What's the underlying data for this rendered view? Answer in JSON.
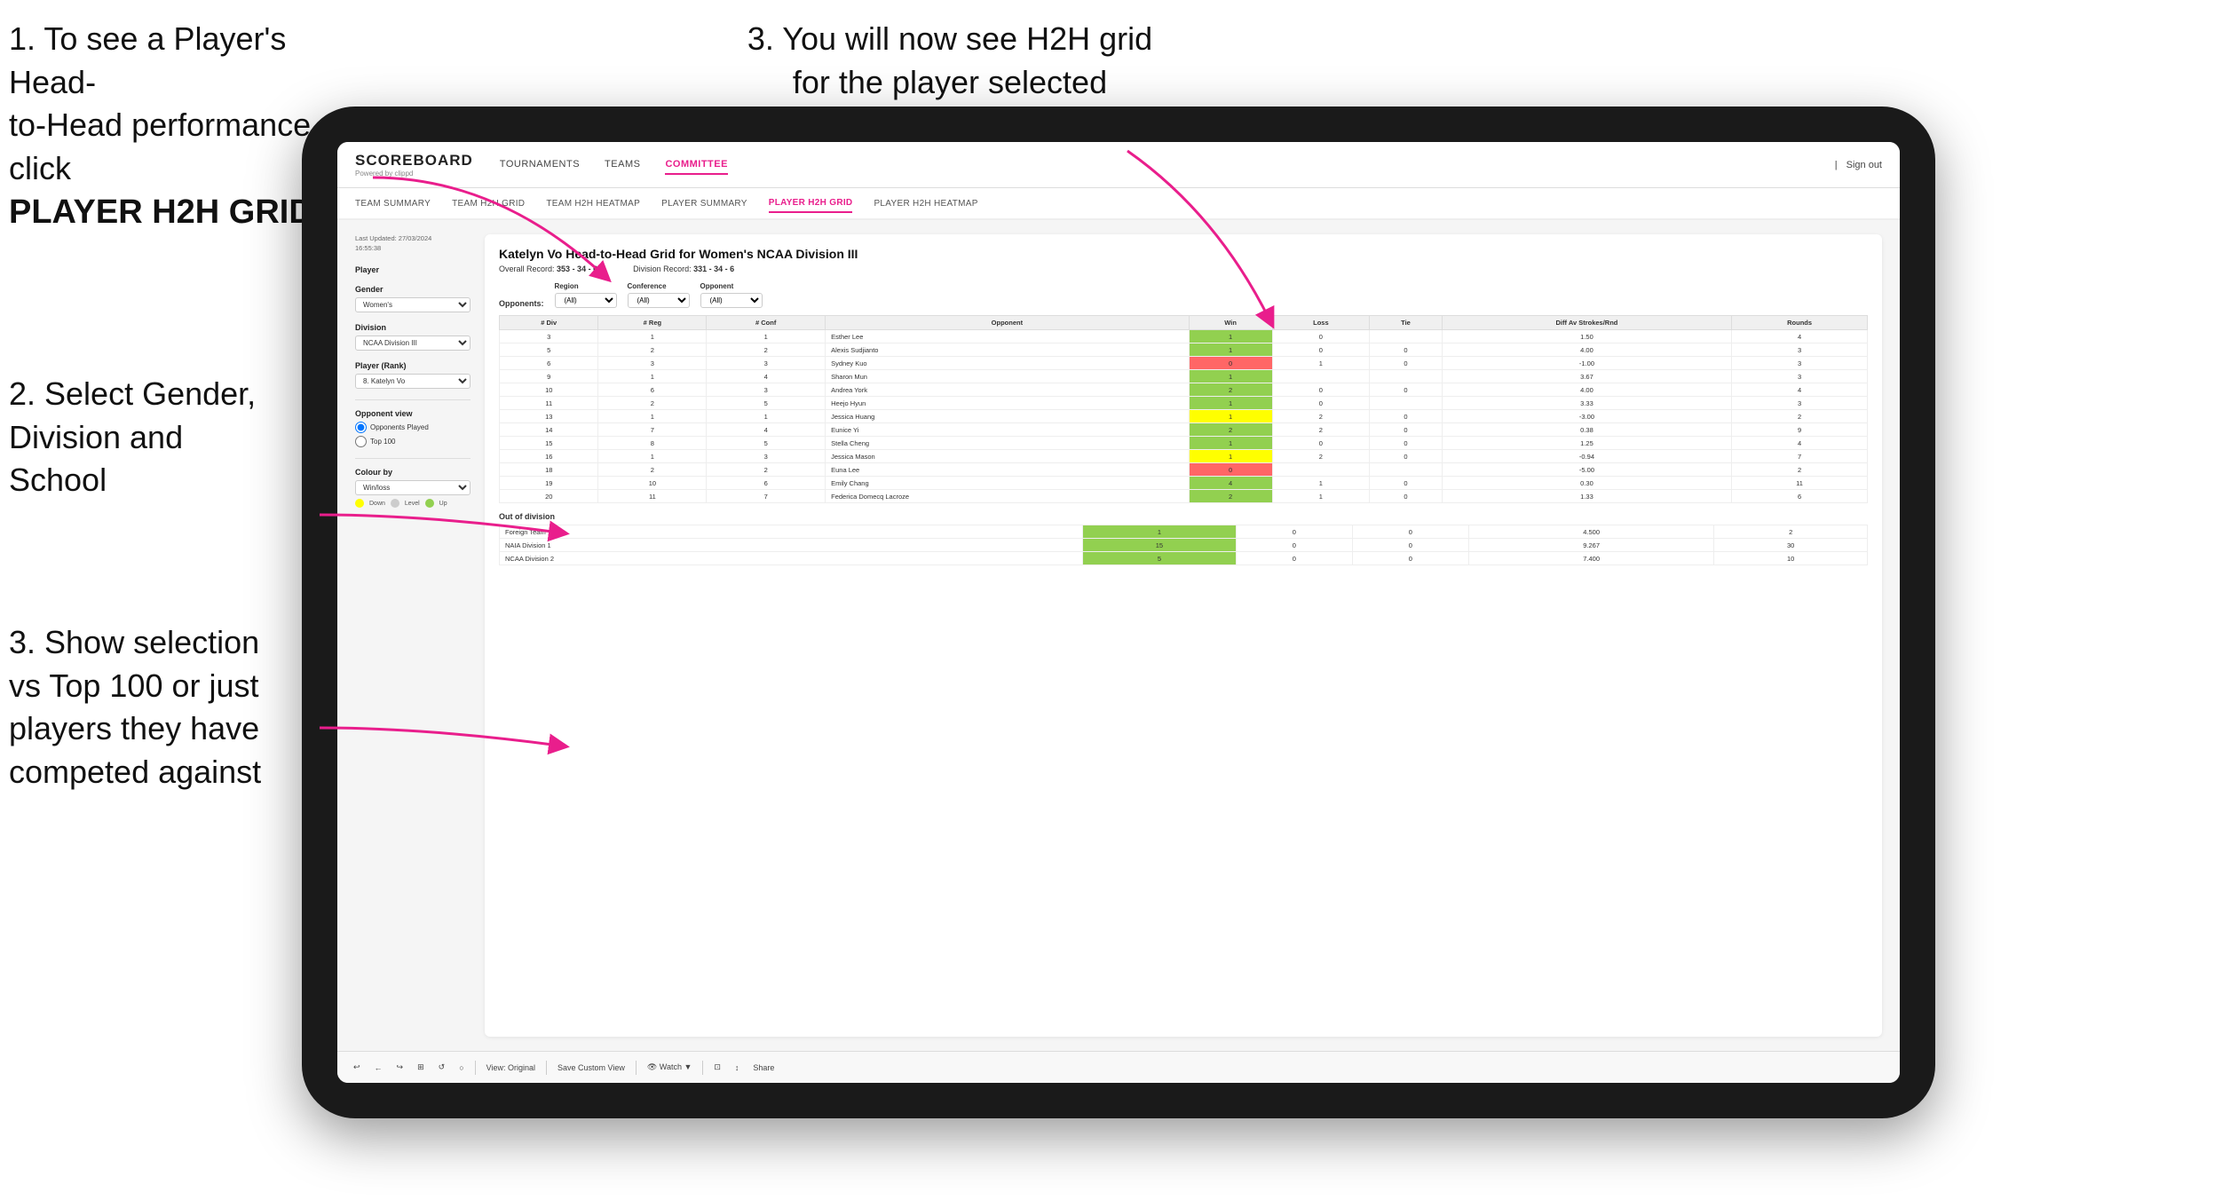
{
  "instructions": {
    "top_left_line1": "1. To see a Player's Head-",
    "top_left_line2": "to-Head performance click",
    "top_left_bold": "PLAYER H2H GRID",
    "top_right": "3. You will now see H2H grid\nfor the player selected",
    "mid_left_line1": "2. Select Gender,",
    "mid_left_line2": "Division and",
    "mid_left_line3": "School",
    "bottom_left_line1": "3. Show selection",
    "bottom_left_line2": "vs Top 100 or just",
    "bottom_left_line3": "players they have",
    "bottom_left_line4": "competed against"
  },
  "nav": {
    "logo": "SCOREBOARD",
    "logo_sub": "Powered by clippd",
    "links": [
      "TOURNAMENTS",
      "TEAMS",
      "COMMITTEE"
    ],
    "active_link": "COMMITTEE",
    "sign_out": "Sign out"
  },
  "sub_nav": {
    "items": [
      "TEAM SUMMARY",
      "TEAM H2H GRID",
      "TEAM H2H HEATMAP",
      "PLAYER SUMMARY",
      "PLAYER H2H GRID",
      "PLAYER H2H HEATMAP"
    ],
    "active": "PLAYER H2H GRID"
  },
  "sidebar": {
    "last_updated_label": "Last Updated: 27/03/2024",
    "last_updated_time": "16:55:38",
    "player_label": "Player",
    "gender_label": "Gender",
    "gender_value": "Women's",
    "division_label": "Division",
    "division_value": "NCAA Division III",
    "player_rank_label": "Player (Rank)",
    "player_rank_value": "8. Katelyn Vo",
    "opponent_view_label": "Opponent view",
    "opponent_option1": "Opponents Played",
    "opponent_option2": "Top 100",
    "colour_by_label": "Colour by",
    "colour_by_value": "Win/loss",
    "legend": [
      {
        "color": "#ffff00",
        "label": "Down"
      },
      {
        "color": "#cccccc",
        "label": "Level"
      },
      {
        "color": "#92d050",
        "label": "Up"
      }
    ]
  },
  "main": {
    "title": "Katelyn Vo Head-to-Head Grid for Women's NCAA Division III",
    "overall_record_label": "Overall Record:",
    "overall_record_value": "353 - 34 - 6",
    "division_record_label": "Division Record:",
    "division_record_value": "331 - 34 - 6",
    "filter_region_label": "Region",
    "filter_conference_label": "Conference",
    "filter_opponent_label": "Opponent",
    "opponents_label": "Opponents:",
    "filter_value": "(All)",
    "table_headers": [
      "# Div",
      "# Reg",
      "# Conf",
      "Opponent",
      "Win",
      "Loss",
      "Tie",
      "Diff Av Strokes/Rnd",
      "Rounds"
    ],
    "rows": [
      {
        "div": "3",
        "reg": "1",
        "conf": "1",
        "opponent": "Esther Lee",
        "win": "1",
        "loss": "0",
        "tie": "",
        "diff": "1.50",
        "rounds": "4",
        "win_color": "green"
      },
      {
        "div": "5",
        "reg": "2",
        "conf": "2",
        "opponent": "Alexis Sudjianto",
        "win": "1",
        "loss": "0",
        "tie": "0",
        "diff": "4.00",
        "rounds": "3",
        "win_color": "green"
      },
      {
        "div": "6",
        "reg": "3",
        "conf": "3",
        "opponent": "Sydney Kuo",
        "win": "0",
        "loss": "1",
        "tie": "0",
        "diff": "-1.00",
        "rounds": "3",
        "win_color": "red"
      },
      {
        "div": "9",
        "reg": "1",
        "conf": "4",
        "opponent": "Sharon Mun",
        "win": "1",
        "loss": "",
        "tie": "",
        "diff": "3.67",
        "rounds": "3",
        "win_color": "green"
      },
      {
        "div": "10",
        "reg": "6",
        "conf": "3",
        "opponent": "Andrea York",
        "win": "2",
        "loss": "0",
        "tie": "0",
        "diff": "4.00",
        "rounds": "4",
        "win_color": "green"
      },
      {
        "div": "11",
        "reg": "2",
        "conf": "5",
        "opponent": "Heejo Hyun",
        "win": "1",
        "loss": "0",
        "tie": "",
        "diff": "3.33",
        "rounds": "3",
        "win_color": "green"
      },
      {
        "div": "13",
        "reg": "1",
        "conf": "1",
        "opponent": "Jessica Huang",
        "win": "1",
        "loss": "2",
        "tie": "0",
        "diff": "-3.00",
        "rounds": "2",
        "win_color": "yellow"
      },
      {
        "div": "14",
        "reg": "7",
        "conf": "4",
        "opponent": "Eunice Yi",
        "win": "2",
        "loss": "2",
        "tie": "0",
        "diff": "0.38",
        "rounds": "9",
        "win_color": "green"
      },
      {
        "div": "15",
        "reg": "8",
        "conf": "5",
        "opponent": "Stella Cheng",
        "win": "1",
        "loss": "0",
        "tie": "0",
        "diff": "1.25",
        "rounds": "4",
        "win_color": "green"
      },
      {
        "div": "16",
        "reg": "1",
        "conf": "3",
        "opponent": "Jessica Mason",
        "win": "1",
        "loss": "2",
        "tie": "0",
        "diff": "-0.94",
        "rounds": "7",
        "win_color": "yellow"
      },
      {
        "div": "18",
        "reg": "2",
        "conf": "2",
        "opponent": "Euna Lee",
        "win": "0",
        "loss": "",
        "tie": "",
        "diff": "-5.00",
        "rounds": "2",
        "win_color": "red"
      },
      {
        "div": "19",
        "reg": "10",
        "conf": "6",
        "opponent": "Emily Chang",
        "win": "4",
        "loss": "1",
        "tie": "0",
        "diff": "0.30",
        "rounds": "11",
        "win_color": "green"
      },
      {
        "div": "20",
        "reg": "11",
        "conf": "7",
        "opponent": "Federica Domecq Lacroze",
        "win": "2",
        "loss": "1",
        "tie": "0",
        "diff": "1.33",
        "rounds": "6",
        "win_color": "green"
      }
    ],
    "out_of_division_label": "Out of division",
    "out_of_division_rows": [
      {
        "name": "Foreign Team",
        "win": "1",
        "loss": "0",
        "tie": "0",
        "diff": "4.500",
        "rounds": "2"
      },
      {
        "name": "NAIA Division 1",
        "win": "15",
        "loss": "0",
        "tie": "0",
        "diff": "9.267",
        "rounds": "30"
      },
      {
        "name": "NCAA Division 2",
        "win": "5",
        "loss": "0",
        "tie": "0",
        "diff": "7.400",
        "rounds": "10"
      }
    ]
  },
  "toolbar": {
    "items": [
      "↩",
      "←",
      "↪",
      "⊞",
      "↺",
      "○",
      "|",
      "View: Original",
      "|",
      "Save Custom View",
      "|",
      "👁 Watch ▼",
      "|",
      "⊡",
      "↕",
      "Share"
    ]
  }
}
